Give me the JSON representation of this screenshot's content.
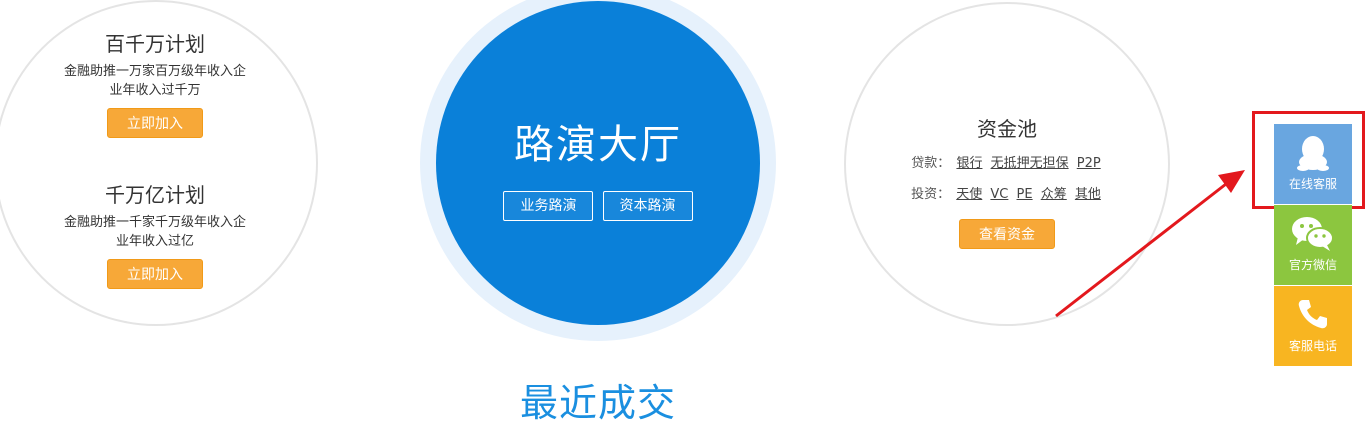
{
  "plans": [
    {
      "title": "百千万计划",
      "desc_line1": "金融助推一万家百万级年收入企",
      "desc_line2": "业年收入过千万",
      "button": "立即加入"
    },
    {
      "title": "千万亿计划",
      "desc_line1": "金融助推一千家千万级年收入企",
      "desc_line2": "业年收入过亿",
      "button": "立即加入"
    }
  ],
  "roadshow": {
    "title": "路演大厅",
    "buttons": [
      "业务路演",
      "资本路演"
    ]
  },
  "fund_pool": {
    "title": "资金池",
    "loan_label": "贷款：",
    "loan_links": [
      "银行",
      "无抵押无担保",
      "P2P"
    ],
    "invest_label": "投资：",
    "invest_links": [
      "天使",
      "VC",
      "PE",
      "众筹",
      "其他"
    ],
    "button": "查看资金"
  },
  "recent_title": "最近成交",
  "side_bar": {
    "online_service": "在线客服",
    "wechat": "官方微信",
    "phone": "客服电话"
  },
  "colors": {
    "roadshow_blue": "#0a80d9",
    "orange_button": "#f7a838",
    "annotation_red": "#e3181d",
    "qq_blue": "#69a6e0",
    "wechat_green": "#8cc63f",
    "phone_yellow": "#f8b521"
  }
}
